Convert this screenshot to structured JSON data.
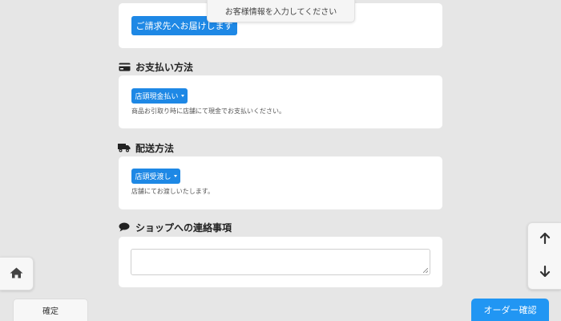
{
  "toast": {
    "text": "お客様情報を入力してください"
  },
  "billing": {
    "button_label": "ご請求先へお届けします"
  },
  "payment": {
    "title": "お支払い方法",
    "icon": "credit-card-icon",
    "dropdown_value": "店頭現金払い",
    "help_text": "商品お引取り時に店舗にて現金でお支払いください。"
  },
  "delivery": {
    "title": "配送方法",
    "icon": "truck-icon",
    "dropdown_value": "店頭受渡し",
    "help_text": "店舗にてお渡しいたします。"
  },
  "message": {
    "title": "ショップへの連絡事項",
    "icon": "comment-icon",
    "textarea_value": ""
  },
  "footer": {
    "confirm_label": "確定",
    "order_label": "オーダー確認"
  },
  "nav": {
    "home_icon": "home-icon",
    "up_icon": "arrow-up-icon",
    "down_icon": "arrow-down-icon"
  },
  "colors": {
    "background": "#e6e6e6",
    "accent": "#1e88e5",
    "order_button": "#2196f3"
  }
}
